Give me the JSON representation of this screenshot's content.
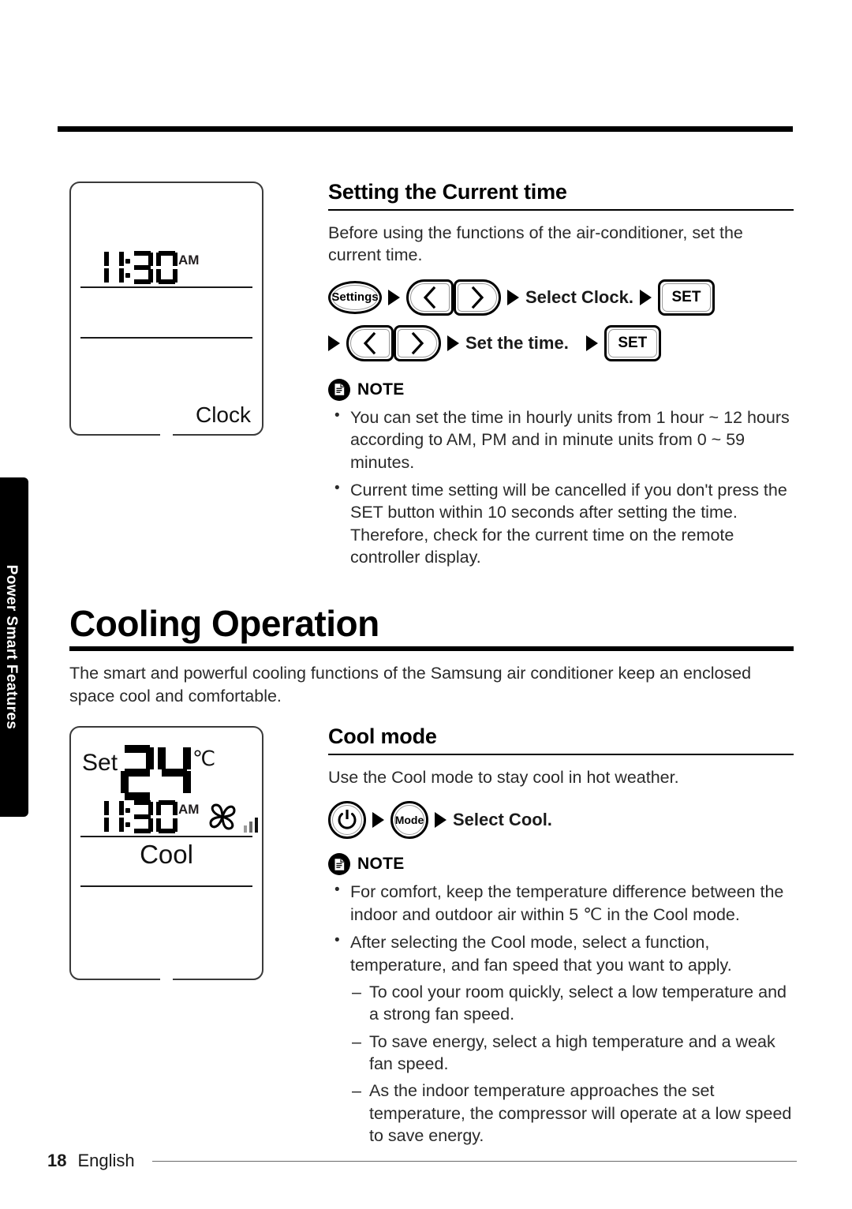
{
  "side_tab": {
    "label": "Power Smart Features"
  },
  "clock_display": {
    "time": "11:30",
    "hours": "11",
    "minutes": "30",
    "meridiem": "AM",
    "mode_label": "Clock"
  },
  "cool_display": {
    "set_label": "Set",
    "temperature": "24",
    "unit": "℃",
    "time": "11:30",
    "hours": "11",
    "minutes": "30",
    "meridiem": "AM",
    "mode_label": "Cool",
    "fan_icon": "fan-pinwheel-icon",
    "fan_level_icon": "fan-speed-bars-icon"
  },
  "clock_section": {
    "heading": "Setting the Current time",
    "intro": "Before using the functions of the air-conditioner, set the current time.",
    "flow_row_1": {
      "settings_button": "Settings",
      "left_arrow": "‹",
      "right_arrow": "›",
      "instruction": "Select Clock.",
      "set_button": "SET"
    },
    "flow_row_2": {
      "left_arrow": "‹",
      "right_arrow": "›",
      "instruction": "Set the time.",
      "set_button": "SET"
    },
    "note": {
      "title": "NOTE",
      "items": [
        "You can set the time in hourly units from 1 hour ~ 12 hours according to AM, PM and in minute units from 0 ~ 59 minutes.",
        "Current time setting will be cancelled if you don't press the SET button within 10 seconds after setting the time. Therefore, check for the current time on the remote controller display."
      ]
    }
  },
  "chapter": {
    "title": "Cooling Operation",
    "intro": "The smart and powerful cooling functions of the Samsung air conditioner keep an enclosed space cool and comfortable."
  },
  "cool_section": {
    "heading": "Cool mode",
    "intro": "Use the Cool mode to stay cool in hot weather.",
    "flow_row": {
      "power_button": "power-icon",
      "mode_button": "Mode",
      "instruction": "Select Cool."
    },
    "note": {
      "title": "NOTE",
      "items": [
        {
          "text": "For comfort, keep the temperature difference between the indoor and outdoor air within 5 ℃ in the Cool mode.",
          "sub": []
        },
        {
          "text": "After selecting the Cool mode, select a function, temperature, and fan speed that you want to apply.",
          "sub": [
            "To cool your room quickly, select a low temperature and a strong fan speed.",
            "To save energy, select a high temperature and a weak fan speed.",
            "As the indoor temperature approaches the set temperature, the compressor will operate at a low speed to save energy."
          ]
        }
      ]
    }
  },
  "footer": {
    "page_number": "18",
    "language": "English"
  },
  "colors": {
    "ink": "#231f20",
    "rule": "#000000",
    "tab_bg": "#000000"
  }
}
